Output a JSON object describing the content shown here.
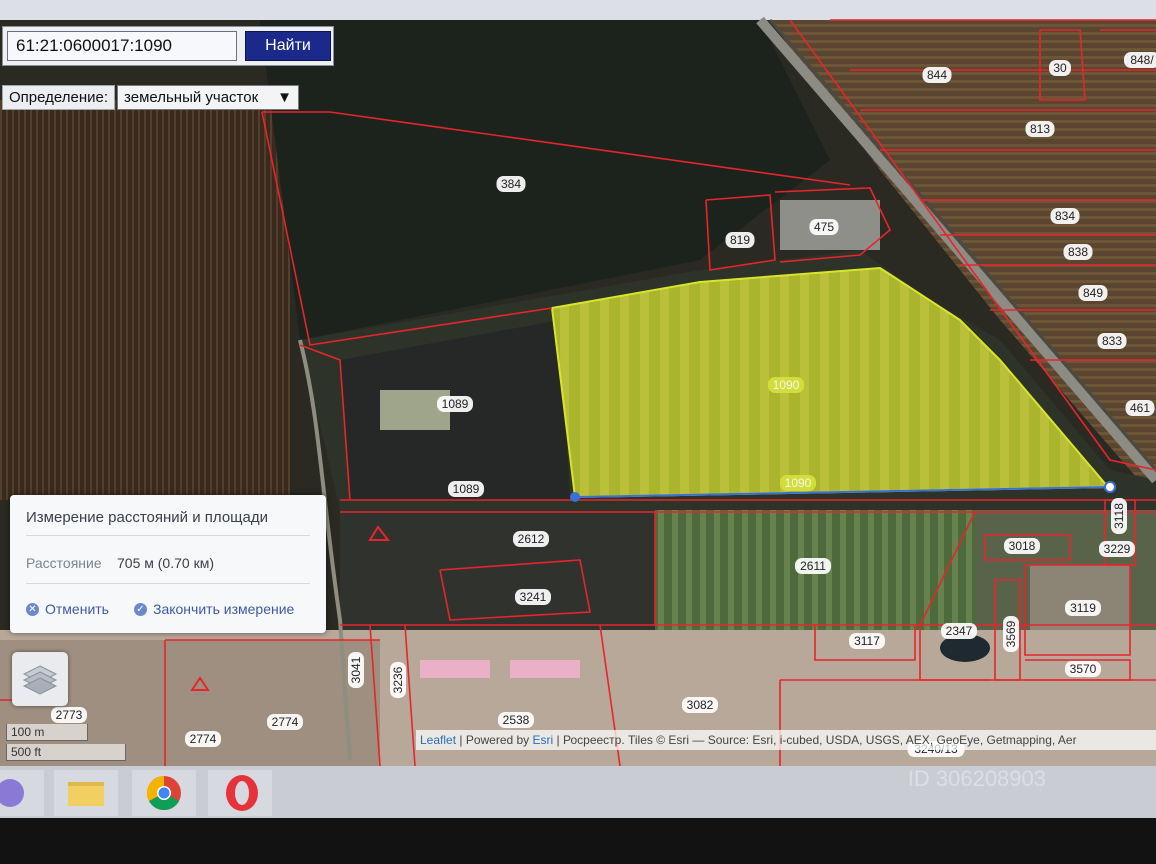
{
  "search": {
    "value": "61:21:0600017:1090",
    "button_label": "Найти"
  },
  "definition": {
    "label": "Определение:",
    "selected": "земельный участок"
  },
  "parcels": [
    {
      "id": "p844",
      "label": "844"
    },
    {
      "id": "p30",
      "label": "30"
    },
    {
      "id": "p848",
      "label": "848/"
    },
    {
      "id": "p813",
      "label": "813"
    },
    {
      "id": "p384",
      "label": "384"
    },
    {
      "id": "p834",
      "label": "834"
    },
    {
      "id": "p819",
      "label": "819"
    },
    {
      "id": "p475",
      "label": "475"
    },
    {
      "id": "p838",
      "label": "838"
    },
    {
      "id": "p849",
      "label": "849"
    },
    {
      "id": "p833",
      "label": "833"
    },
    {
      "id": "p1090a",
      "label": "1090"
    },
    {
      "id": "p1089a",
      "label": "1089"
    },
    {
      "id": "p461",
      "label": "461"
    },
    {
      "id": "p1089b",
      "label": "1089"
    },
    {
      "id": "p1090b",
      "label": "1090"
    },
    {
      "id": "p3118",
      "label": "3118"
    },
    {
      "id": "p3018",
      "label": "3018"
    },
    {
      "id": "p3229",
      "label": "3229"
    },
    {
      "id": "p2612",
      "label": "2612"
    },
    {
      "id": "p2611",
      "label": "2611"
    },
    {
      "id": "p3241",
      "label": "3241"
    },
    {
      "id": "p3119",
      "label": "3119"
    },
    {
      "id": "p3117",
      "label": "3117"
    },
    {
      "id": "p2347",
      "label": "2347"
    },
    {
      "id": "p3569",
      "label": "3569"
    },
    {
      "id": "p3570",
      "label": "3570"
    },
    {
      "id": "p3041",
      "label": "3041"
    },
    {
      "id": "p3236",
      "label": "3236"
    },
    {
      "id": "p2773",
      "label": "2773"
    },
    {
      "id": "p2774a",
      "label": "2774"
    },
    {
      "id": "p2774b",
      "label": "2774"
    },
    {
      "id": "p2538",
      "label": "2538"
    },
    {
      "id": "p3082",
      "label": "3082"
    },
    {
      "id": "p3240",
      "label": "3240/13"
    }
  ],
  "measure": {
    "title": "Измерение расстояний и площади",
    "distance_label": "Расстояние",
    "distance_value": "705 м (0.70 км)",
    "cancel_label": "Отменить",
    "finish_label": "Закончить измерение"
  },
  "scale": {
    "metric": "100 m",
    "imperial": "500 ft"
  },
  "attribution": {
    "leaflet": "Leaflet",
    "powered": " | Powered by ",
    "esri": "Esri",
    "rest": " | Росреестр. Tiles © Esri — Source: Esri, i-cubed, USDA, USGS, AEX, GeoEye, Getmapping, Aer"
  },
  "watermark": "ID 306208903",
  "icons": {
    "layers": "layers-icon",
    "cancel": "cancel-icon",
    "finish": "check-icon",
    "dropdown": "chevron-down-icon"
  },
  "colors": {
    "parcel_border": "#e8242c",
    "highlight": "#d9e52a",
    "measure_line": "#3a6fd8",
    "search_button": "#1b2a8a"
  }
}
